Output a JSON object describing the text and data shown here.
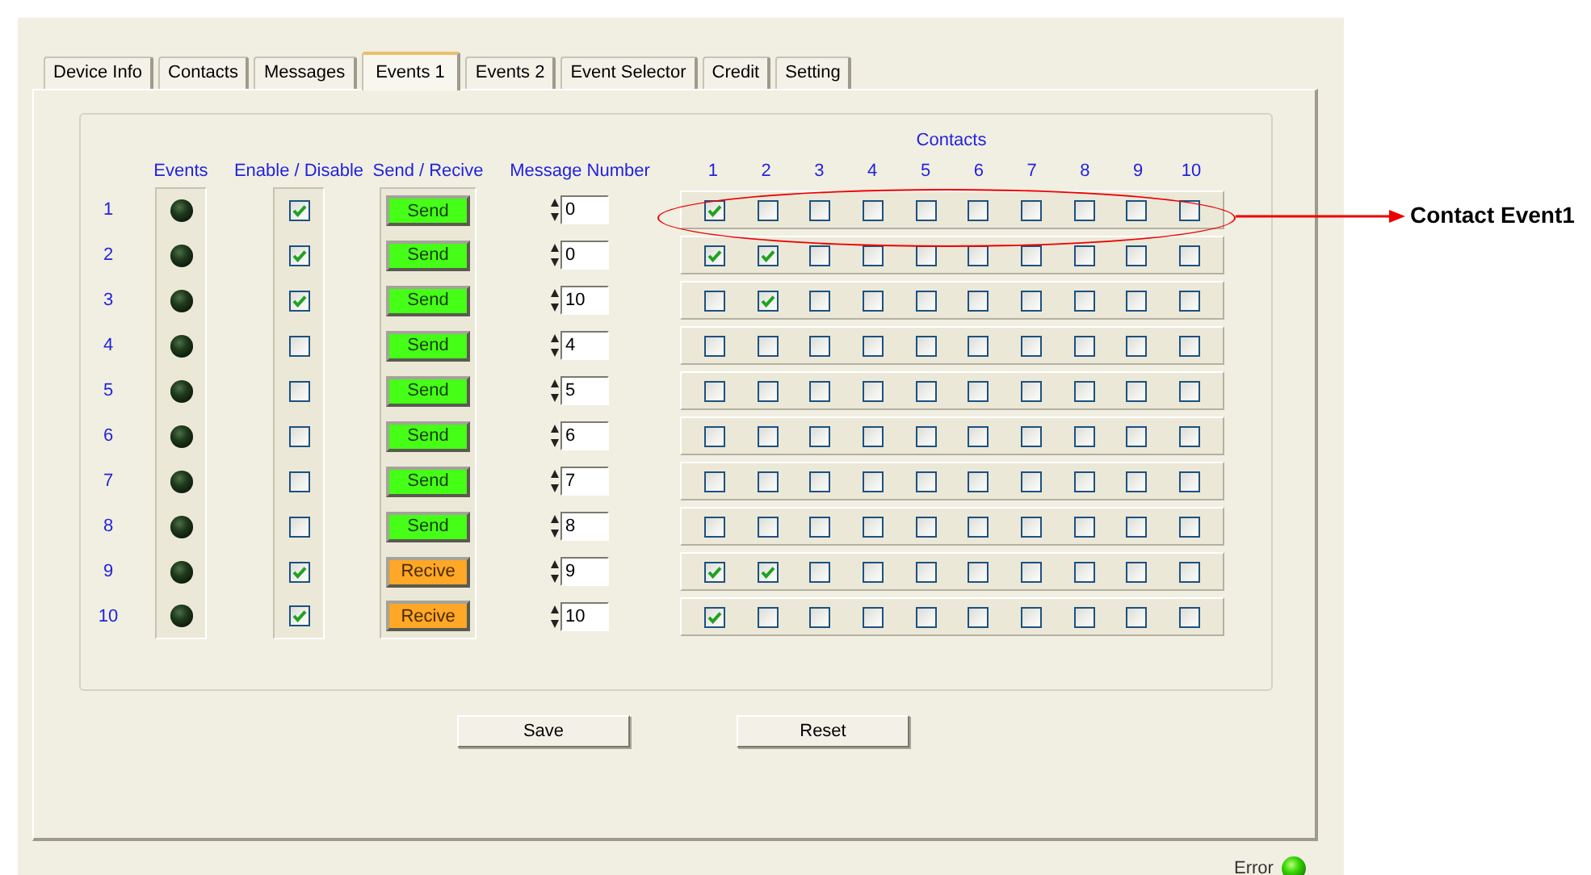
{
  "tabs": [
    {
      "label": "Device Info",
      "selected": false
    },
    {
      "label": "Contacts",
      "selected": false
    },
    {
      "label": "Messages",
      "selected": false
    },
    {
      "label": "Events 1",
      "selected": true
    },
    {
      "label": "Events 2",
      "selected": false
    },
    {
      "label": "Event Selector",
      "selected": false
    },
    {
      "label": "Credit",
      "selected": false
    },
    {
      "label": "Setting",
      "selected": false
    }
  ],
  "columns": {
    "events": "Events",
    "enable": "Enable / Disable",
    "direction": "Send / Recive",
    "message": "Message Number",
    "contacts": "Contacts",
    "contact_numbers": [
      "1",
      "2",
      "3",
      "4",
      "5",
      "6",
      "7",
      "8",
      "9",
      "10"
    ]
  },
  "rows": [
    {
      "label": "1",
      "event_lit": false,
      "enabled": true,
      "direction": {
        "kind": "send",
        "label": "Send"
      },
      "message": "0",
      "contacts": [
        true,
        false,
        false,
        false,
        false,
        false,
        false,
        false,
        false,
        false
      ]
    },
    {
      "label": "2",
      "event_lit": false,
      "enabled": true,
      "direction": {
        "kind": "send",
        "label": "Send"
      },
      "message": "0",
      "contacts": [
        true,
        true,
        false,
        false,
        false,
        false,
        false,
        false,
        false,
        false
      ]
    },
    {
      "label": "3",
      "event_lit": false,
      "enabled": true,
      "direction": {
        "kind": "send",
        "label": "Send"
      },
      "message": "10",
      "contacts": [
        false,
        true,
        false,
        false,
        false,
        false,
        false,
        false,
        false,
        false
      ]
    },
    {
      "label": "4",
      "event_lit": false,
      "enabled": false,
      "direction": {
        "kind": "send",
        "label": "Send"
      },
      "message": "4",
      "contacts": [
        false,
        false,
        false,
        false,
        false,
        false,
        false,
        false,
        false,
        false
      ]
    },
    {
      "label": "5",
      "event_lit": false,
      "enabled": false,
      "direction": {
        "kind": "send",
        "label": "Send"
      },
      "message": "5",
      "contacts": [
        false,
        false,
        false,
        false,
        false,
        false,
        false,
        false,
        false,
        false
      ]
    },
    {
      "label": "6",
      "event_lit": false,
      "enabled": false,
      "direction": {
        "kind": "send",
        "label": "Send"
      },
      "message": "6",
      "contacts": [
        false,
        false,
        false,
        false,
        false,
        false,
        false,
        false,
        false,
        false
      ]
    },
    {
      "label": "7",
      "event_lit": false,
      "enabled": false,
      "direction": {
        "kind": "send",
        "label": "Send"
      },
      "message": "7",
      "contacts": [
        false,
        false,
        false,
        false,
        false,
        false,
        false,
        false,
        false,
        false
      ]
    },
    {
      "label": "8",
      "event_lit": false,
      "enabled": false,
      "direction": {
        "kind": "send",
        "label": "Send"
      },
      "message": "8",
      "contacts": [
        false,
        false,
        false,
        false,
        false,
        false,
        false,
        false,
        false,
        false
      ]
    },
    {
      "label": "9",
      "event_lit": false,
      "enabled": true,
      "direction": {
        "kind": "receive",
        "label": "Recive"
      },
      "message": "9",
      "contacts": [
        true,
        true,
        false,
        false,
        false,
        false,
        false,
        false,
        false,
        false
      ]
    },
    {
      "label": "10",
      "event_lit": false,
      "enabled": true,
      "direction": {
        "kind": "receive",
        "label": "Recive"
      },
      "message": "10",
      "contacts": [
        true,
        false,
        false,
        false,
        false,
        false,
        false,
        false,
        false,
        false
      ]
    }
  ],
  "buttons": [
    "Save",
    "Reset"
  ],
  "status": {
    "label": "Error",
    "lit": true
  },
  "annotation": {
    "label": "Contact Event1"
  }
}
